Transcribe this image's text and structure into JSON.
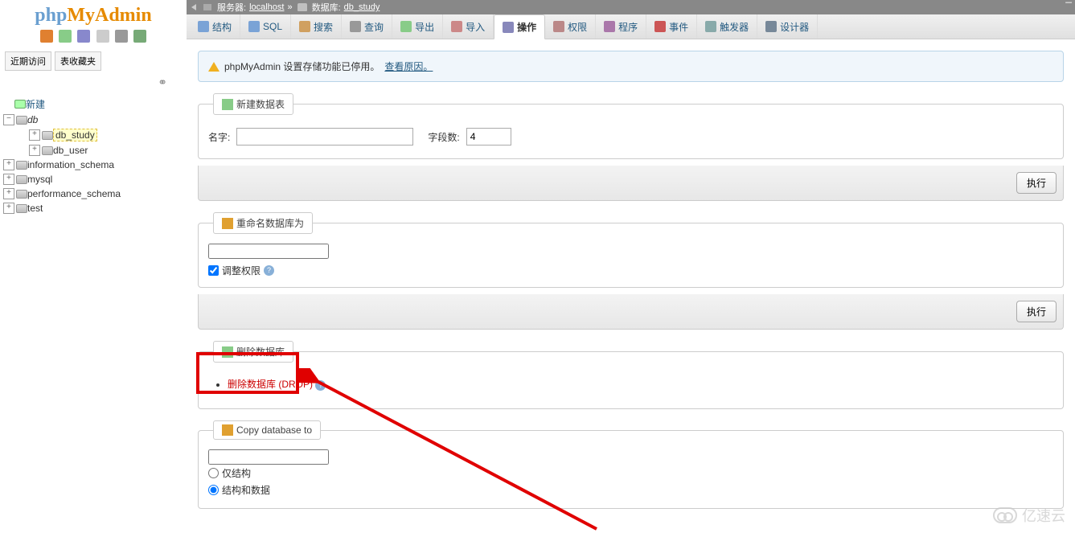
{
  "logo": {
    "p1": "php",
    "p2": "MyAdmin"
  },
  "sidebar": {
    "recent_btn": "近期访问",
    "fav_btn": "表收藏夹",
    "new_label": "新建",
    "tree": [
      {
        "label": "db",
        "root": true
      },
      {
        "label": "db_study",
        "indent": 2,
        "active": true
      },
      {
        "label": "db_user",
        "indent": 2
      },
      {
        "label": "information_schema",
        "indent": 1
      },
      {
        "label": "mysql",
        "indent": 1
      },
      {
        "label": "performance_schema",
        "indent": 1
      },
      {
        "label": "test",
        "indent": 1
      }
    ]
  },
  "breadcrumb": {
    "server_label": "服务器:",
    "server_value": "localhost",
    "sep": "»",
    "db_label": "数据库:",
    "db_value": "db_study"
  },
  "tabs": [
    {
      "label": "结构",
      "icon": "i-structure"
    },
    {
      "label": "SQL",
      "icon": "i-sql"
    },
    {
      "label": "搜索",
      "icon": "i-search"
    },
    {
      "label": "查询",
      "icon": "i-query"
    },
    {
      "label": "导出",
      "icon": "i-export"
    },
    {
      "label": "导入",
      "icon": "i-import"
    },
    {
      "label": "操作",
      "icon": "i-ops",
      "active": true
    },
    {
      "label": "权限",
      "icon": "i-priv"
    },
    {
      "label": "程序",
      "icon": "i-routines"
    },
    {
      "label": "事件",
      "icon": "i-events"
    },
    {
      "label": "触发器",
      "icon": "i-trig"
    },
    {
      "label": "设计器",
      "icon": "i-designer"
    }
  ],
  "notice": {
    "text": "phpMyAdmin 设置存储功能已停用。",
    "link": "查看原因。"
  },
  "panel_new": {
    "legend": "新建数据表",
    "name_label": "名字:",
    "name_value": "",
    "fields_label": "字段数:",
    "fields_value": "4",
    "submit": "执行"
  },
  "panel_rename": {
    "legend": "重命名数据库为",
    "value": "",
    "adjust_priv": "调整权限",
    "submit": "执行"
  },
  "panel_drop": {
    "legend": "删除数据库",
    "drop_link": "删除数据库 (DROP)"
  },
  "panel_copy": {
    "legend": "Copy database to",
    "value": "",
    "opt_structure": "仅结构",
    "opt_both": "结构和数据"
  },
  "watermark": "亿速云"
}
